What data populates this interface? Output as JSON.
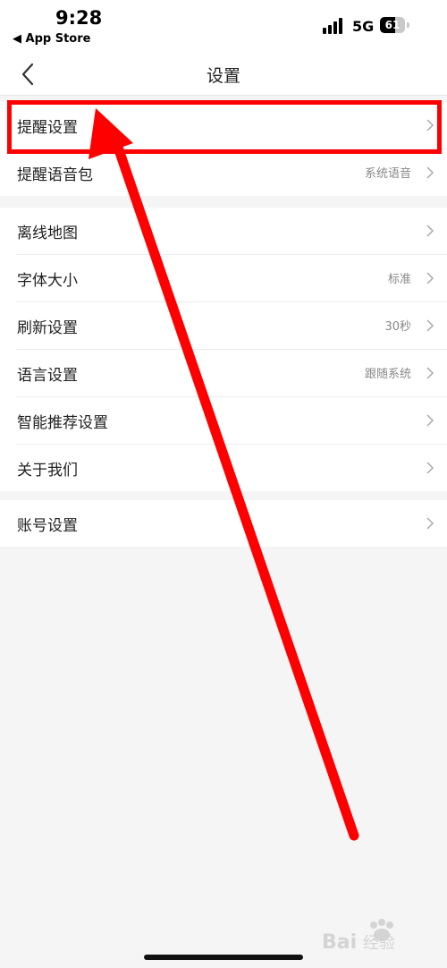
{
  "status": {
    "time": "9:28",
    "back_app": "◀ App Store",
    "network": "5G",
    "battery": "61",
    "battery_level": 0.61
  },
  "nav": {
    "title": "设置",
    "back_icon": "chevron-left-icon"
  },
  "groups": [
    {
      "rows": [
        {
          "label": "提醒设置",
          "value": ""
        },
        {
          "label": "提醒语音包",
          "value": "系统语音"
        }
      ]
    },
    {
      "rows": [
        {
          "label": "离线地图",
          "value": ""
        },
        {
          "label": "字体大小",
          "value": "标准"
        },
        {
          "label": "刷新设置",
          "value": "30秒"
        },
        {
          "label": "语言设置",
          "value": "跟随系统"
        },
        {
          "label": "智能推荐设置",
          "value": ""
        },
        {
          "label": "关于我们",
          "value": ""
        }
      ]
    },
    {
      "rows": [
        {
          "label": "账号设置",
          "value": ""
        }
      ]
    }
  ],
  "annotation": {
    "highlight_color": "#ff0000"
  },
  "watermark": {
    "text": "Bai经验"
  }
}
